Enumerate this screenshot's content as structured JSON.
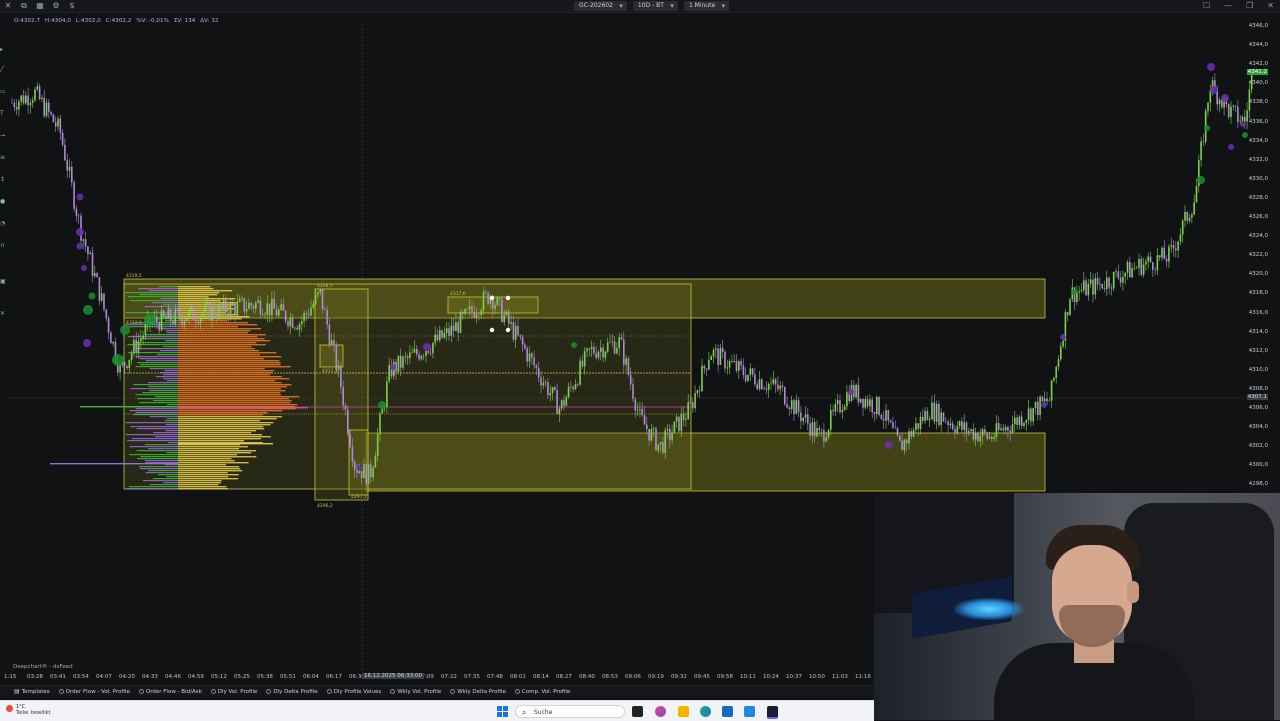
{
  "toolbar": {
    "symbol": "GC-202602",
    "timeframe": "10D - BT",
    "interval": "1 Minute"
  },
  "ohlc": {
    "open": "O:4302,7",
    "high": "H:4304,0",
    "low": "L:4302,0",
    "close": "C:4302,2",
    "change": "%V: -0,01%",
    "volume": "ΣV: 134",
    "delta": "ΔV: 32"
  },
  "price_axis": {
    "ticks": [
      "4346,0",
      "4344,0",
      "4342,0",
      "4340,0",
      "4338,0",
      "4336,0",
      "4334,0",
      "4332,0",
      "4330,0",
      "4328,0",
      "4326,0",
      "4324,0",
      "4322,0",
      "4320,0",
      "4318,0",
      "4316,0",
      "4314,0",
      "4312,0",
      "4310,0",
      "4308,0",
      "4306,0",
      "4304,0",
      "4302,0",
      "4300,0",
      "4298,0"
    ],
    "last_price": "4341,2",
    "cursor_price": "4307,1"
  },
  "time_axis": {
    "ticks": [
      "1:15",
      "03:28",
      "03:41",
      "03:54",
      "04:07",
      "04:20",
      "04:33",
      "04:46",
      "04:59",
      "05:12",
      "05:25",
      "05:38",
      "05:51",
      "06:04",
      "06:17",
      "06:30",
      "06:43",
      "06:56",
      "07:09",
      "07:22",
      "07:35",
      "07:48",
      "08:01",
      "08:14",
      "08:27",
      "08:40",
      "08:53",
      "09:06",
      "09:19",
      "09:32",
      "09:45",
      "09:58",
      "10:11",
      "10:24",
      "10:37",
      "10:50",
      "11:03",
      "11:16"
    ],
    "cursor_time": "16.12.2025 06:33:00"
  },
  "chart_labels": {
    "box1_top": "4319,5",
    "box1_mid": "4313,8",
    "box2_top": "4318,7",
    "box2_bottom": "4296,2",
    "box2_low": "4297,1",
    "box3_top": "4317,6",
    "box3_mid": "4311,5"
  },
  "credit": "Deepchart® - dxFeed",
  "bottom_bar": {
    "templates": "Templates",
    "items": [
      "Order Flow - Vol. Profile",
      "Order Flow - Bid/Ask",
      "Dly Vol. Profile",
      "Dly Delta Profile",
      "Dly Profile Values",
      "Wkly Vol. Profile",
      "Wkly Delta Profile",
      "Comp. Vol. Profile"
    ]
  },
  "taskbar": {
    "temperature": "1°C",
    "weather": "Teilw. bewölkt",
    "search_placeholder": "Suche"
  },
  "colors": {
    "background": "#111214",
    "up_candle": "#7cd34a",
    "down_candle": "#b08ad6",
    "box_fill": "#6b6a1a",
    "box_border": "#c9c23a",
    "profile_orange": "#e8731f",
    "profile_yellow": "#e3c84a",
    "profile_purple": "#9a6bdb",
    "profile_green": "#3db83a",
    "dot_green": "#1e8c2e",
    "dot_purple": "#6a2fb0"
  },
  "icons": [
    "settings-icon",
    "camera-icon",
    "dollar-icon",
    "maximize-icon",
    "minimize-icon",
    "restore-icon",
    "close-icon",
    "search-icon",
    "windows-start-icon"
  ]
}
